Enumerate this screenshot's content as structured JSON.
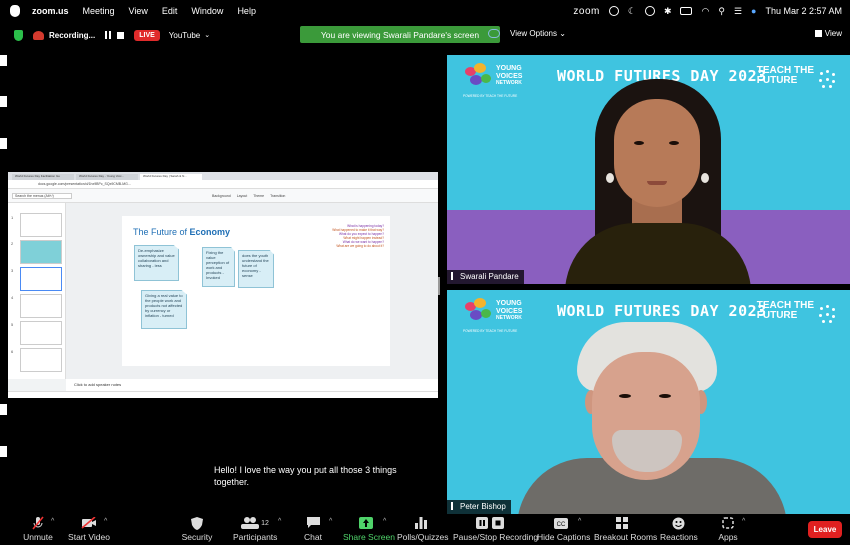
{
  "menubar": {
    "app_name": "zoom.us",
    "menus": [
      "Meeting",
      "View",
      "Edit",
      "Window",
      "Help"
    ],
    "zoom_label": "zoom",
    "datetime": "Thu Mar 2  2:57 AM"
  },
  "statusbar": {
    "recording_label": "Recording...",
    "live_label": "LIVE",
    "stream_target": "YouTube",
    "viewing_banner": "You are viewing Swarali Pandare's screen",
    "view_options_label": "View Options",
    "view_label": "View"
  },
  "shared_screen": {
    "tabs": [
      "World Futures Day Facilitation Gu",
      "World Futures Day - Young Voic...",
      "World Futures Day | Sarah & N..."
    ],
    "url": "docs.google.com/presentation/d/1hx9BPc_SQx9CMB-MG...",
    "search_placeholder": "Search the menus (Alt+/)",
    "toolbar_items": [
      "Background",
      "Layout",
      "Theme",
      "Transition"
    ],
    "slide_title_plain": "The Future of ",
    "slide_title_bold": "Economy",
    "questions": [
      "What is happening today?",
      "What happened to make it that way?",
      "What do you expect to happen?",
      "What might happen instead?",
      "What do we want to happen?",
      "What are we going to do about it?"
    ],
    "notes": [
      "De-emphasize ownership and value collaboration and sharing - less",
      "Fixing the value perception of work and products - Invoked",
      "does the youth understand the future of economy - sense",
      "Giving a real value to the people work and products not affected by currency or inflation - turned"
    ],
    "speaker_notes": "Click to add speaker notes",
    "slide_numbers": [
      "1",
      "2",
      "3",
      "4",
      "5",
      "6",
      "7"
    ]
  },
  "tiles": [
    {
      "participant": "Swarali Pandare",
      "banner": {
        "org_line1": "YOUNG",
        "org_line2": "VOICES",
        "org_line3": "NETWORK",
        "powered": "POWERED BY TEACH THE FUTURE",
        "event": "WORLD FUTURES DAY 2023",
        "brand_line1": "TEACH THE",
        "brand_line2": "FUTURE"
      }
    },
    {
      "participant": "Peter Bishop",
      "banner": {
        "org_line1": "YOUNG",
        "org_line2": "VOICES",
        "org_line3": "NETWORK",
        "powered": "POWERED BY TEACH THE FUTURE",
        "event": "WORLD FUTURES DAY 2023",
        "brand_line1": "TEACH THE",
        "brand_line2": "FUTURE"
      }
    }
  ],
  "caption": {
    "line1": "Hello! I love the way you put all those 3 things",
    "line2": "together."
  },
  "toolbar": {
    "unmute": "Unmute",
    "start_video": "Start Video",
    "security": "Security",
    "participants": "Participants",
    "participants_count": "12",
    "chat": "Chat",
    "share_screen": "Share Screen",
    "polls": "Polls/Quizzes",
    "recording": "Pause/Stop Recording",
    "hide_captions": "Hide Captions",
    "breakout": "Breakout Rooms",
    "reactions": "Reactions",
    "apps": "Apps",
    "leave": "Leave"
  },
  "colors": {
    "zoom_green": "#3b9a3a",
    "live_red": "#e02b2b",
    "leave_red": "#e02020",
    "tile_teal": "#3fc4e0",
    "tile_purple": "#8a5fbf",
    "share_screen_green": "#4fd36a"
  }
}
